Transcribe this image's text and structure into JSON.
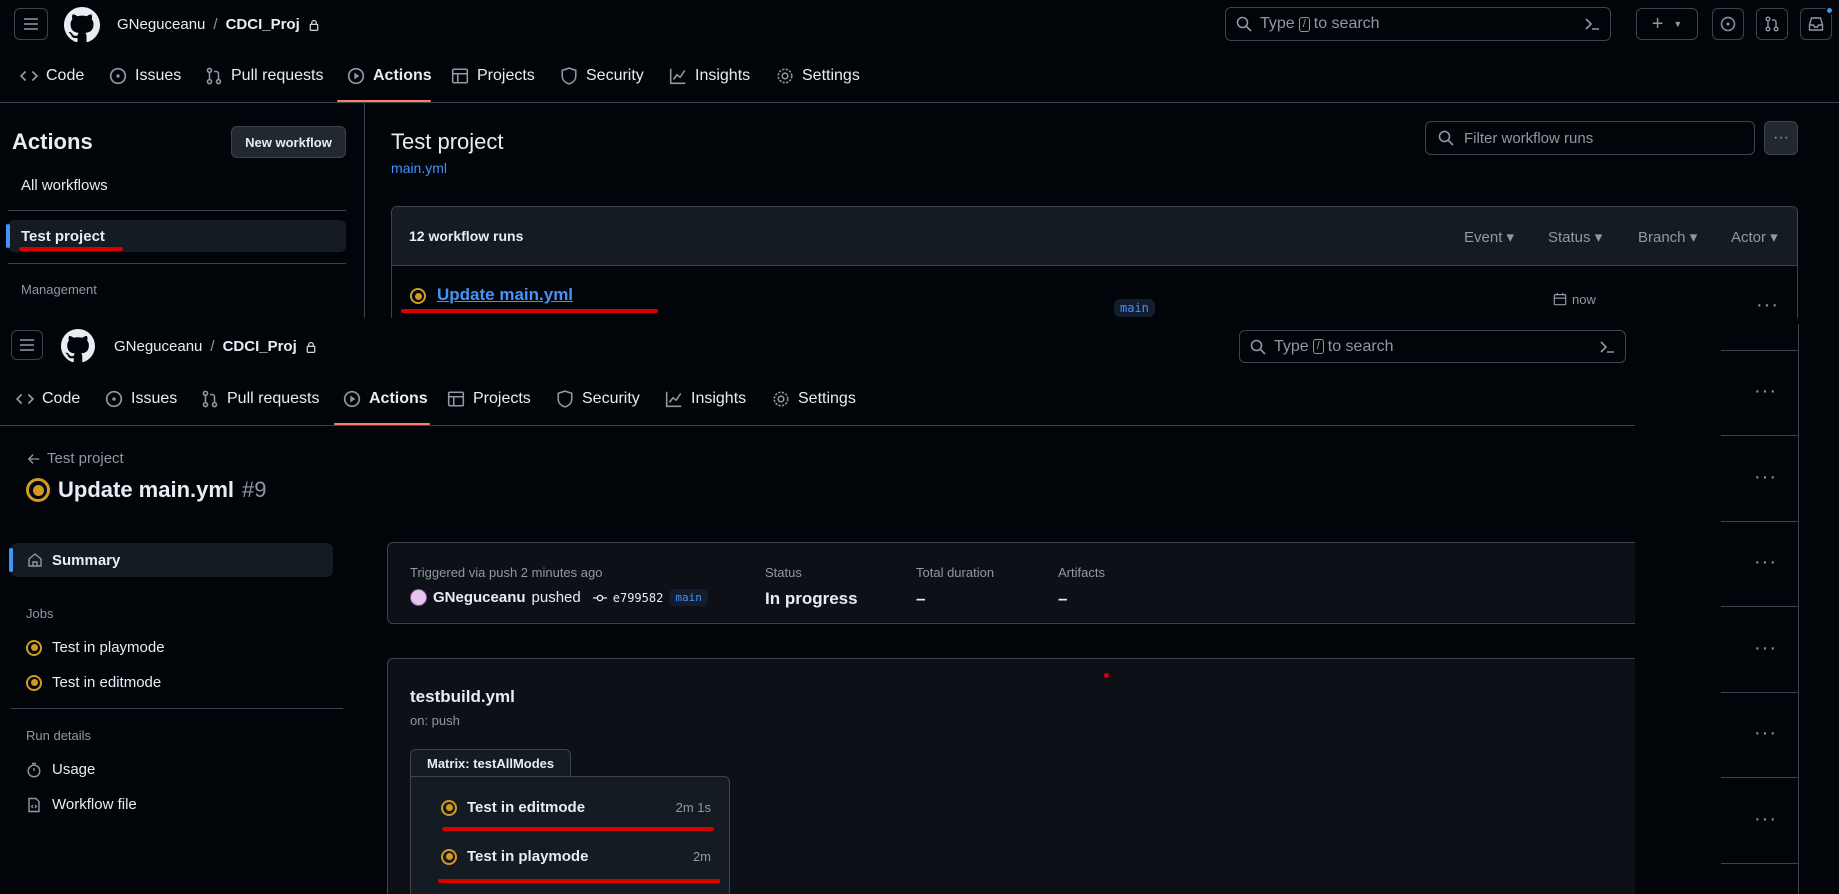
{
  "top": {
    "header": {
      "owner": "GNeguceanu",
      "sep": "/",
      "repo": "CDCI_Proj",
      "search_placeholder_pre": "Type",
      "search_key": "/",
      "search_placeholder_post": "to search"
    },
    "tabs": [
      "Code",
      "Issues",
      "Pull requests",
      "Actions",
      "Projects",
      "Security",
      "Insights",
      "Settings"
    ],
    "sidebar": {
      "title": "Actions",
      "new_workflow": "New workflow",
      "all_workflows": "All workflows",
      "selected": "Test project",
      "management": "Management"
    },
    "main": {
      "title": "Test project",
      "file": "main.yml",
      "filter_placeholder": "Filter workflow runs",
      "runs_count": "12 workflow runs",
      "filters": [
        "Event",
        "Status",
        "Branch",
        "Actor"
      ],
      "run": {
        "name": "Update main.yml",
        "branch": "main",
        "time": "now"
      }
    }
  },
  "bottom": {
    "header": {
      "owner": "GNeguceanu",
      "sep": "/",
      "repo": "CDCI_Proj",
      "search_placeholder_pre": "Type",
      "search_key": "/",
      "search_placeholder_post": "to search"
    },
    "tabs": [
      "Code",
      "Issues",
      "Pull requests",
      "Actions",
      "Projects",
      "Security",
      "Insights",
      "Settings"
    ],
    "back_link": "Test project",
    "run_title": "Update main.yml",
    "run_number": "#9",
    "sidebar": {
      "summary": "Summary",
      "jobs_heading": "Jobs",
      "jobs": [
        "Test in playmode",
        "Test in editmode"
      ],
      "run_details_heading": "Run details",
      "usage": "Usage",
      "workflow_file": "Workflow file"
    },
    "summary": {
      "triggered": "Triggered via push 2 minutes ago",
      "user": "GNeguceanu",
      "action": "pushed",
      "commit": "e799582",
      "branch": "main",
      "status_label": "Status",
      "status_value": "In progress",
      "duration_label": "Total duration",
      "duration_value": "–",
      "artifacts_label": "Artifacts",
      "artifacts_value": "–"
    },
    "workflow": {
      "file": "testbuild.yml",
      "trigger": "on: push",
      "matrix_label": "Matrix: testAllModes",
      "jobs": [
        {
          "name": "Test in editmode",
          "duration": "2m 1s"
        },
        {
          "name": "Test in playmode",
          "duration": "2m"
        }
      ]
    }
  },
  "colors": {
    "bg": "#010409",
    "accent_tab": "#f78166",
    "running": "#d29922",
    "link": "#4493f8",
    "annotation": "#d80000"
  }
}
